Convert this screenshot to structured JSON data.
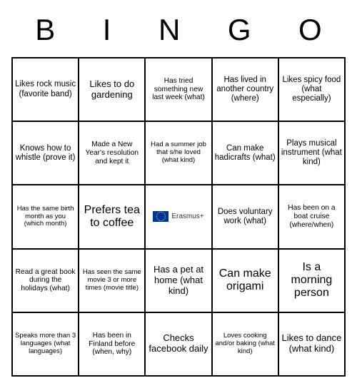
{
  "header": [
    "B",
    "I",
    "N",
    "G",
    "O"
  ],
  "center_logo_text": "Erasmus+",
  "cells": [
    [
      {
        "text": "Likes rock music (favorite band)",
        "size": "fs-sm"
      },
      {
        "text": "Likes to do gardening",
        "size": "fs-md"
      },
      {
        "text": "Has tried something new last week (what)",
        "size": "fs-xs"
      },
      {
        "text": "Has lived in another country (where)",
        "size": "fs-sm"
      },
      {
        "text": "Likes spicy food (what especially)",
        "size": "fs-sm"
      }
    ],
    [
      {
        "text": "Knows how to whistle (prove it)",
        "size": "fs-sm"
      },
      {
        "text": "Made a New Year's resolution and kept it",
        "size": "fs-xs"
      },
      {
        "text": "Had a summer job that s/he loved (what kind)",
        "size": "fs-xxs"
      },
      {
        "text": "Can make hadicrafts (what)",
        "size": "fs-sm"
      },
      {
        "text": "Plays musical instrument (what kind)",
        "size": "fs-sm"
      }
    ],
    [
      {
        "text": "Has the same birth month as you (which month)",
        "size": "fs-xxs"
      },
      {
        "text": "Prefers tea to coffee",
        "size": "fs-lg"
      },
      {
        "text": "",
        "size": "center"
      },
      {
        "text": "Does voluntary work (what)",
        "size": "fs-sm"
      },
      {
        "text": "Has been on a boat cruise (where/when)",
        "size": "fs-xs"
      }
    ],
    [
      {
        "text": "Read a great book during the holidays (what)",
        "size": "fs-xs"
      },
      {
        "text": "Has seen the same movie 3 or more times (movie title)",
        "size": "fs-xxs"
      },
      {
        "text": "Has a pet at home (what kind)",
        "size": "fs-md"
      },
      {
        "text": "Can make origami",
        "size": "fs-lg"
      },
      {
        "text": "Is a morning person",
        "size": "fs-lg"
      }
    ],
    [
      {
        "text": "Speaks more than 3 languages (what languages)",
        "size": "fs-xxs"
      },
      {
        "text": "Has been in Finland before (when, why)",
        "size": "fs-xs"
      },
      {
        "text": "Checks facebook daily",
        "size": "fs-md"
      },
      {
        "text": "Loves cooking and/or baking (what kind)",
        "size": "fs-xxs"
      },
      {
        "text": "Likes to dance (what kind)",
        "size": "fs-md"
      }
    ]
  ]
}
